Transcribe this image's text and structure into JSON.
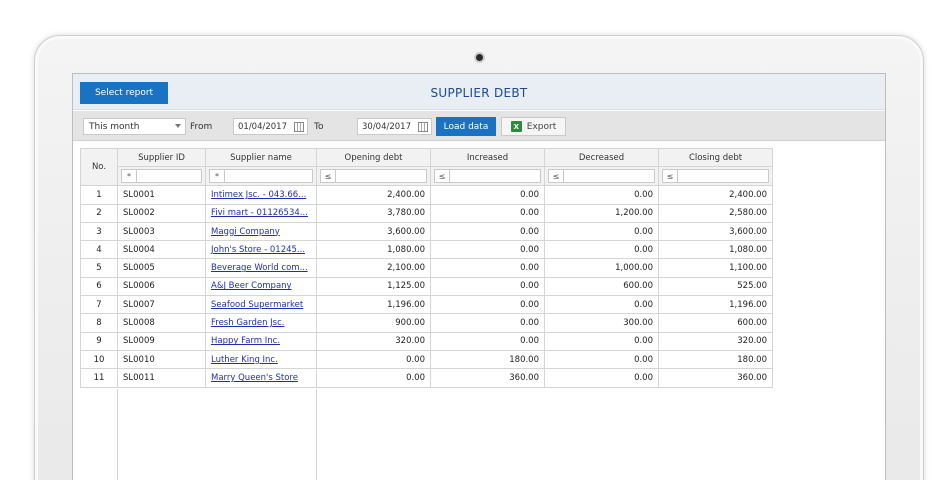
{
  "header": {
    "select_report_label": "Select report",
    "title": "SUPPLIER DEBT"
  },
  "toolbar": {
    "period": "This month",
    "from_label": "From",
    "from_date": "01/04/2017",
    "to_label": "To",
    "to_date": "30/04/2017",
    "load_label": "Load data",
    "export_label": "Export",
    "excel_glyph": "X"
  },
  "grid": {
    "columns": [
      "No.",
      "Supplier ID",
      "Supplier name",
      "Opening debt",
      "Increased",
      "Decreased",
      "Closing debt"
    ],
    "filter_ops": [
      "*",
      "*",
      "≤",
      "≤",
      "≤",
      "≤"
    ],
    "rows": [
      [
        "1",
        "SL0001",
        "Intimex Jsc. - 043.66...",
        "2,400.00",
        "0.00",
        "0.00",
        "2,400.00"
      ],
      [
        "2",
        "SL0002",
        "Fivi mart - 01126534...",
        "3,780.00",
        "0.00",
        "1,200.00",
        "2,580.00"
      ],
      [
        "3",
        "SL0003",
        "Maggi Company",
        "3,600.00",
        "0.00",
        "0.00",
        "3,600.00"
      ],
      [
        "4",
        "SL0004",
        "John's Store - 01245...",
        "1,080.00",
        "0.00",
        "0.00",
        "1,080.00"
      ],
      [
        "5",
        "SL0005",
        "Beverage World com...",
        "2,100.00",
        "0.00",
        "1,000.00",
        "1,100.00"
      ],
      [
        "6",
        "SL0006",
        "A&J Beer Company",
        "1,125.00",
        "0.00",
        "600.00",
        "525.00"
      ],
      [
        "7",
        "SL0007",
        "Seafood Supermarket",
        "1,196.00",
        "0.00",
        "0.00",
        "1,196.00"
      ],
      [
        "8",
        "SL0008",
        "Fresh Garden Jsc.",
        "900.00",
        "0.00",
        "300.00",
        "600.00"
      ],
      [
        "9",
        "SL0009",
        "Happy Farm Inc.",
        "320.00",
        "0.00",
        "0.00",
        "320.00"
      ],
      [
        "10",
        "SL0010",
        "Luther King Inc.",
        "0.00",
        "180.00",
        "0.00",
        "180.00"
      ],
      [
        "11",
        "SL0011",
        "Marry Queen's Store",
        "0.00",
        "360.00",
        "0.00",
        "360.00"
      ]
    ]
  },
  "colors": {
    "accent": "#1a73c2",
    "title": "#1d4a8f",
    "link": "#1f2fb3"
  }
}
